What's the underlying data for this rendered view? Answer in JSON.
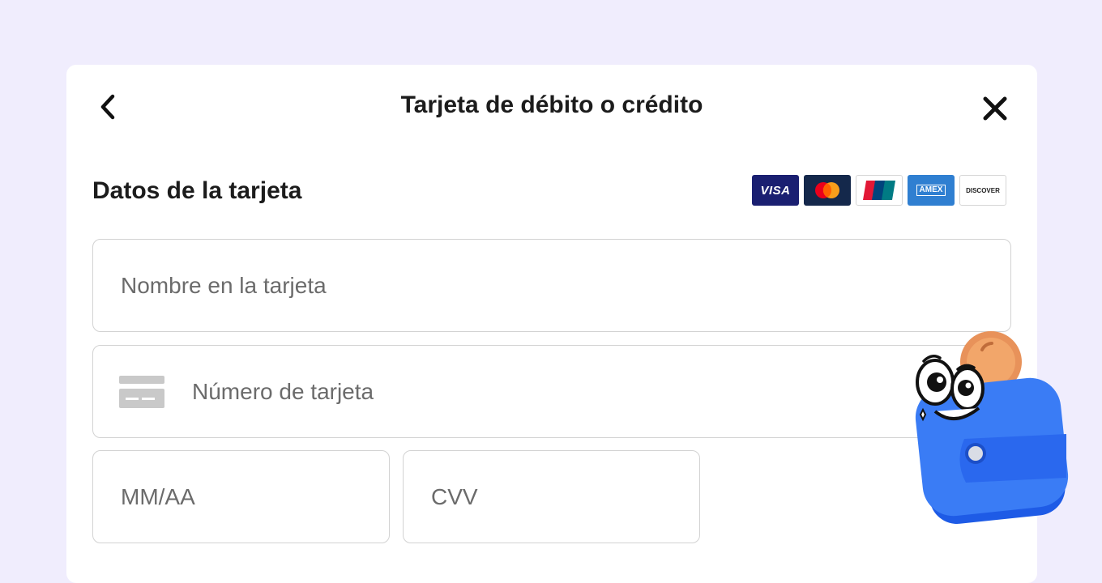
{
  "modal": {
    "title": "Tarjeta de débito o crédito"
  },
  "section": {
    "title": "Datos de la tarjeta"
  },
  "brands": [
    {
      "name": "visa",
      "label": "VISA"
    },
    {
      "name": "mastercard",
      "label": ""
    },
    {
      "name": "unionpay",
      "label": ""
    },
    {
      "name": "amex",
      "label": "AMEX"
    },
    {
      "name": "discover",
      "label": "DISCOVER"
    }
  ],
  "fields": {
    "name": {
      "value": "",
      "placeholder": "Nombre en la tarjeta"
    },
    "number": {
      "value": "",
      "placeholder": "Número de tarjeta"
    },
    "expiry": {
      "value": "",
      "placeholder": "MM/AA"
    },
    "cvv": {
      "value": "",
      "placeholder": "CVV"
    }
  },
  "icons": {
    "back": "chevron-left-icon",
    "close": "close-icon",
    "card": "credit-card-icon",
    "mascot": "wallet-mascot-icon"
  },
  "colors": {
    "background": "#f0edfd",
    "panel": "#ffffff",
    "border": "#d2d2d2",
    "placeholder": "#6b6b6b",
    "text": "#1c1c1c",
    "mascot_blue": "#2b6ff2",
    "coin": "#f0a057"
  }
}
